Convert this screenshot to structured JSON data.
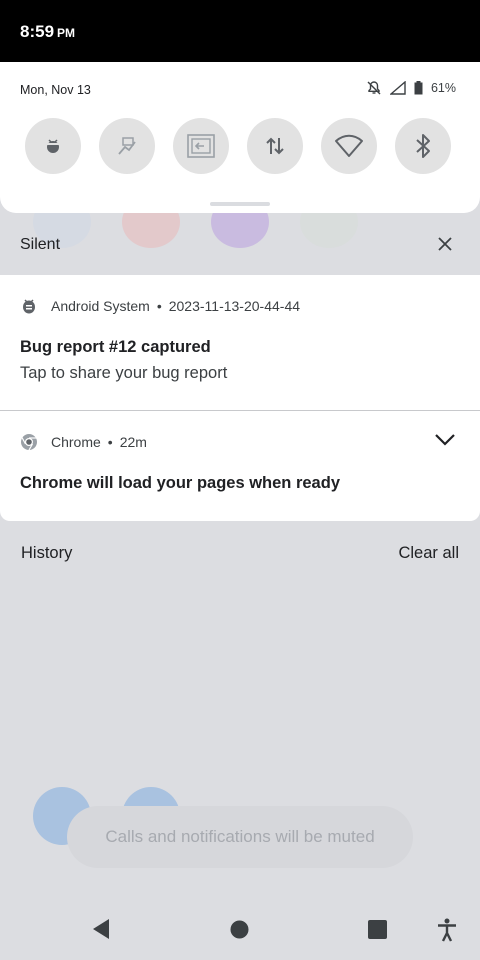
{
  "status_bar": {
    "time": "8:59",
    "ampm": "PM"
  },
  "quick_settings": {
    "date": "Mon, Nov 13",
    "battery": "61%",
    "tiles": [
      {
        "name": "bug-report-tile",
        "icon": "bug-icon"
      },
      {
        "name": "usb-debugging-tile",
        "icon": "developer-icon"
      },
      {
        "name": "screen-cast-tile",
        "icon": "cast-icon"
      },
      {
        "name": "mobile-data-tile",
        "icon": "data-arrows-icon"
      },
      {
        "name": "wifi-tile",
        "icon": "wifi-icon"
      },
      {
        "name": "bluetooth-tile",
        "icon": "bluetooth-icon"
      }
    ]
  },
  "silent_section": {
    "title": "Silent"
  },
  "notifications": [
    {
      "app": "Android System",
      "time": "2023-11-13-20-44-44",
      "title": "Bug report #12 captured",
      "text": "Tap to share your bug report"
    },
    {
      "app": "Chrome",
      "time": "22m",
      "title": "Chrome will load your pages when ready"
    }
  ],
  "footer": {
    "history_label": "History",
    "clear_label": "Clear all"
  },
  "toast": {
    "text": "Calls and notifications will be muted"
  },
  "colors": {
    "accent": "#1a73e8",
    "panel": "#ffffff",
    "scrim": "#dcdde1"
  }
}
